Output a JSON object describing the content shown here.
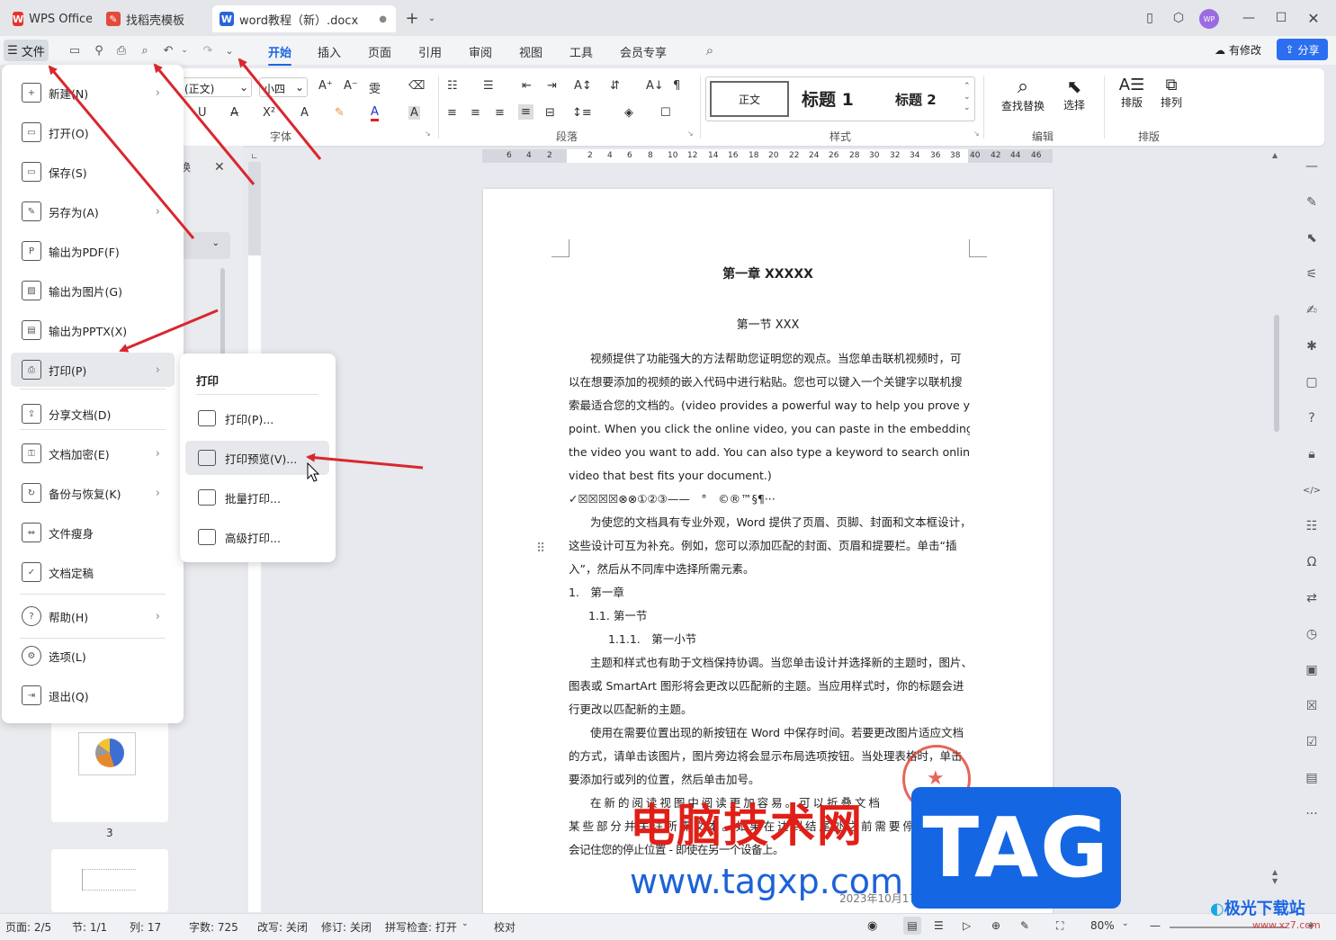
{
  "titlebar": {
    "tabs": [
      {
        "label": "WPS Office",
        "icon": "wps-logo-icon"
      },
      {
        "label": "找稻壳模板",
        "icon": "docer-icon"
      },
      {
        "label": "word教程（新）.docx",
        "icon": "word-doc-icon"
      }
    ],
    "avatar": "WP"
  },
  "menubar": {
    "file_label": "文件",
    "tabs": [
      "开始",
      "插入",
      "页面",
      "引用",
      "审阅",
      "视图",
      "工具",
      "会员专享"
    ],
    "active_tab": "开始",
    "changes_label": "有修改",
    "share_label": "分享"
  },
  "ribbon": {
    "font_name": "(正文)",
    "font_size": "小四",
    "style_normal": "正文",
    "style_h1": "标题 1",
    "style_h2": "标题 2",
    "group_font": "字体",
    "group_paragraph": "段落",
    "group_styles": "样式",
    "group_edit": "编辑",
    "group_layout": "排版",
    "find_replace": "查找替换",
    "select": "选择",
    "arrange": "排版",
    "order": "排列"
  },
  "file_menu": {
    "items": [
      {
        "label": "新建(N)",
        "icon": "new-doc-icon",
        "submenu": true
      },
      {
        "label": "打开(O)",
        "icon": "folder-open-icon",
        "submenu": false
      },
      {
        "label": "保存(S)",
        "icon": "save-icon",
        "submenu": false
      },
      {
        "label": "另存为(A)",
        "icon": "save-as-icon",
        "submenu": true
      },
      {
        "label": "输出为PDF(F)",
        "icon": "export-pdf-icon",
        "submenu": false
      },
      {
        "label": "输出为图片(G)",
        "icon": "export-image-icon",
        "submenu": false
      },
      {
        "label": "输出为PPTX(X)",
        "icon": "export-pptx-icon",
        "submenu": false
      },
      {
        "label": "打印(P)",
        "icon": "print-icon",
        "submenu": true
      },
      {
        "label": "分享文档(D)",
        "icon": "share-icon",
        "submenu": false
      },
      {
        "label": "文档加密(E)",
        "icon": "encrypt-icon",
        "submenu": true
      },
      {
        "label": "备份与恢复(K)",
        "icon": "backup-icon",
        "submenu": true
      },
      {
        "label": "文件瘦身",
        "icon": "slim-icon",
        "submenu": false
      },
      {
        "label": "文档定稿",
        "icon": "finalize-icon",
        "submenu": false
      },
      {
        "label": "帮助(H)",
        "icon": "help-icon",
        "submenu": true
      },
      {
        "label": "选项(L)",
        "icon": "options-icon",
        "submenu": false
      },
      {
        "label": "退出(Q)",
        "icon": "exit-icon",
        "submenu": false
      }
    ]
  },
  "print_submenu": {
    "title": "打印",
    "items": [
      "打印(P)...",
      "打印预览(V)...",
      "批量打印...",
      "高级打印..."
    ]
  },
  "thumbnail_label": "3",
  "ruler_ticks": [
    "6",
    "4",
    "2",
    "2",
    "4",
    "6",
    "8",
    "10",
    "12",
    "14",
    "16",
    "18",
    "20",
    "22",
    "24",
    "26",
    "28",
    "30",
    "32",
    "34",
    "36",
    "38",
    "40",
    "42",
    "44",
    "46"
  ],
  "document": {
    "chapter_title": "第一章 XXXXX",
    "section_title": "第一节 XXX",
    "lines": [
      "视频提供了功能强大的方法帮助您证明您的观点。当您单击联机视频时，可",
      "以在想要添加的视频的嵌入代码中进行粘贴。您也可以键入一个关键字以联机搜",
      "索最适合您的文档的。(video provides a powerful way to help you prove your",
      "point. When you click the online video, you can paste in the embedding code for",
      "the video you want to add. You can also type a keyword to search online for the",
      "video that best fits your document.)",
      "✓☒☒☒☒⊗⊗①②③——　°　©®™§¶···",
      "为使您的文档具有专业外观，Word 提供了页眉、页脚、封面和文本框设计，",
      "这些设计可互为补充。例如，您可以添加匹配的封面、页眉和提要栏。单击“插",
      "入”，然后从不同库中选择所需元素。",
      "1.　第一章",
      "1.1. 第一节",
      "1.1.1.　第一小节",
      "主题和样式也有助于文档保持协调。当您单击设计并选择新的主题时，图片、",
      "图表或 SmartArt 图形将会更改以匹配新的主题。当应用样式时，你的标题会进",
      "行更改以匹配新的主题。",
      "使用在需要位置出现的新按钮在 Word 中保存时间。若要更改图片适应文档",
      "的方式，请单击该图片，图片旁边将会显示布局选项按钮。当处理表格时，单击",
      "要添加行或列的位置，然后单击加号。",
      "在 新 的 阅 读 视 图 中 阅 读 更 加 容 易 。 可 以 折 叠 文 档",
      "某 些 部 分 并 关 注 所 需 文 本 。 如 果 在 达 到 结 尾 处 之 前 需 要 停 止 读 取 ， Word",
      "会记住您的停止位置 - 即使在另一个设备上。"
    ],
    "date_line": "2023年10月17日星期二"
  },
  "statusbar": {
    "page": "页面: 2/5",
    "section": "节: 1/1",
    "column": "列: 17",
    "words": "字数: 725",
    "revise_mode": "改写: 关闭",
    "track": "修订: 关闭",
    "spellcheck": "拼写检查: 打开",
    "proof": "校对",
    "zoom": "80%"
  },
  "watermark": {
    "text1": "电脑技术网",
    "text2": "www.tagxp.com",
    "tag": "TAG",
    "site": "极光下载站",
    "site_url": "www.xz7.com"
  },
  "colors": {
    "accent": "#1b66e3",
    "arrow": "#d9272e",
    "wps_red": "#e8322d"
  }
}
